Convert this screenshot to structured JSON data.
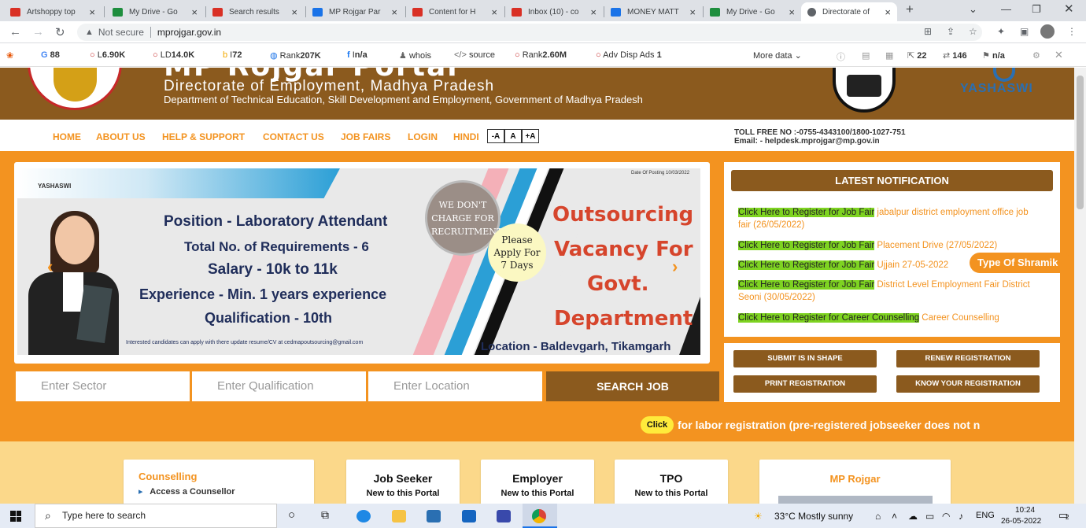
{
  "browser": {
    "tabs": [
      {
        "label": "Artshoppy top",
        "color": "#d93025"
      },
      {
        "label": "My Drive - Go",
        "color": "#1e8e3e"
      },
      {
        "label": "Search results",
        "color": "#d93025"
      },
      {
        "label": "MP Rojgar Par",
        "color": "#1a73e8"
      },
      {
        "label": "Content for H",
        "color": "#d93025"
      },
      {
        "label": "Inbox (10) - co",
        "color": "#d93025"
      },
      {
        "label": "MONEY MATT",
        "color": "#1a73e8"
      },
      {
        "label": "My Drive - Go",
        "color": "#1e8e3e"
      },
      {
        "label": "Directorate of",
        "color": "#5f6368"
      }
    ],
    "new_tab": "+",
    "security": "Not secure",
    "url": "mprojgar.gov.in"
  },
  "extbar": {
    "g": "88",
    "l": "6.90K",
    "ld": "14.0K",
    "b": "72",
    "rank": "207K",
    "fb": "n/a",
    "whois": "whois",
    "source": "source",
    "rank2": "2.60M",
    "adv": "Adv Disp Ads",
    "adv_count": "1",
    "more": "More data",
    "c1": "22",
    "c2": "146",
    "c3": "n/a"
  },
  "header": {
    "portal": "MP Rojgar Portal",
    "directorate": "Directorate of Employment, Madhya Pradesh",
    "department": "Department of Technical Education, Skill Development and Employment, Government of Madhya Pradesh",
    "brand": "YASHASWI"
  },
  "nav": {
    "items": [
      "HOME",
      "ABOUT US",
      "HELP & SUPPORT",
      "CONTACT US",
      "JOB FAIRS",
      "LOGIN",
      "HINDI"
    ],
    "font_sizes": [
      "-A",
      "A",
      "+A"
    ],
    "tollfree": "TOLL FREE NO :-0755-4343100/1800-1027-751",
    "email": "Email: - helpdesk.mprojgar@mp.gov.in"
  },
  "banner": {
    "brand": "YASHASWI",
    "posting_date": "Date Of Posting 10/03/2022",
    "position": "Position - Laboratory Attendant",
    "requirements": "Total No. of Requirements - 6",
    "salary": "Salary - 10k to 11k",
    "experience": "Experience - Min. 1 years experience",
    "qualification": "Qualification - 10th",
    "note": "Interested candidates can apply with there update resume/CV at cedmapoutsourcing@gmail.com",
    "no_charge": "WE DON'T CHARGE FOR RECRUITMENT",
    "apply": "Please Apply For 7 Days",
    "headline_1": "Outsourcing",
    "headline_2": "Vacancy For",
    "headline_3": "Govt.",
    "headline_4": "Department",
    "location": "Location - Baldevgarh, Tikamgarh"
  },
  "notifications": {
    "title": "LATEST NOTIFICATION",
    "items": [
      {
        "link": "Click Here to Register for Job Fair",
        "text": " jabalpur district employment office job fair (26/05/2022)"
      },
      {
        "link": "Click Here to Register for Job Fair",
        "text": " Placement Drive (27/05/2022)"
      },
      {
        "link": "Click Here to Register for Job Fair",
        "text": " Ujjain 27-05-2022"
      },
      {
        "link": "Click Here to Register for Job Fair",
        "text": " District Level Employment Fair District Seoni (30/05/2022)"
      },
      {
        "link": "Click Here to Register for Career Counselling",
        "text": " Career Counselling"
      }
    ],
    "shramik": "Type Of Shramik"
  },
  "actions": [
    "SUBMIT IS IN SHAPE",
    "RENEW REGISTRATION",
    "PRINT REGISTRATION",
    "KNOW YOUR REGISTRATION"
  ],
  "search": {
    "sector": "Enter Sector",
    "qualification": "Enter Qualification",
    "location": "Enter Location",
    "button": "SEARCH JOB"
  },
  "marquee": {
    "click": "Click",
    "text": "for labor registration (pre-registered jobseeker does not n"
  },
  "cards": {
    "counselling": "Counselling",
    "counsellor": "Access a Counsellor",
    "jobseeker": "Job Seeker",
    "employer": "Employer",
    "tpo": "TPO",
    "new_portal": "New to this Portal",
    "mprojgar": "MP Rojgar"
  },
  "taskbar": {
    "search": "Type here to search",
    "weather": "33°C  Mostly sunny",
    "lang": "ENG",
    "time": "10:24",
    "date": "26-05-2022",
    "notif_count": "2"
  }
}
